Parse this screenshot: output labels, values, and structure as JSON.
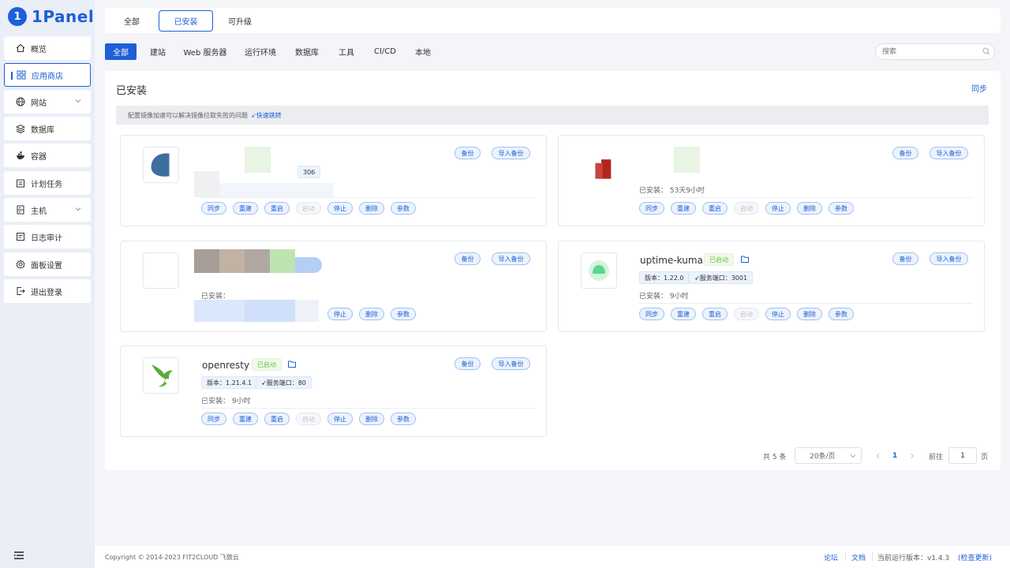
{
  "brand": {
    "name": "1Panel",
    "accent": "#1d5fd6"
  },
  "sidebar": {
    "items": [
      {
        "label": "概览",
        "icon": "home-icon"
      },
      {
        "label": "应用商店",
        "icon": "apps-grid-icon",
        "active": true
      },
      {
        "label": "网站",
        "icon": "globe-icon",
        "expandable": true
      },
      {
        "label": "数据库",
        "icon": "database-icon"
      },
      {
        "label": "容器",
        "icon": "docker-icon"
      },
      {
        "label": "计划任务",
        "icon": "calendar-icon"
      },
      {
        "label": "主机",
        "icon": "server-icon",
        "expandable": true
      },
      {
        "label": "日志审计",
        "icon": "log-icon"
      },
      {
        "label": "面板设置",
        "icon": "gear-icon"
      },
      {
        "label": "退出登录",
        "icon": "logout-icon"
      }
    ]
  },
  "top_tabs": [
    {
      "label": "全部"
    },
    {
      "label": "已安装",
      "active": true
    },
    {
      "label": "可升级"
    }
  ],
  "filters": [
    {
      "label": "全部",
      "active": true
    },
    {
      "label": "建站"
    },
    {
      "label": "Web 服务器"
    },
    {
      "label": "运行环境"
    },
    {
      "label": "数据库"
    },
    {
      "label": "工具"
    },
    {
      "label": "CI/CD"
    },
    {
      "label": "本地"
    }
  ],
  "search": {
    "placeholder": "搜索"
  },
  "panel": {
    "title": "已安装",
    "sync_label": "同步",
    "notice": "配置镜像加速可以解决镜像拉取失败的问题",
    "notice_link": "快速跳转"
  },
  "card_actions": [
    "同步",
    "重建",
    "重启",
    "启动",
    "停止",
    "删除",
    "参数"
  ],
  "card_top_actions": [
    "备份",
    "导入备份"
  ],
  "cards": [
    {
      "name": "",
      "status": "",
      "version": "",
      "port": "306",
      "installed": "",
      "obscured": true
    },
    {
      "name": "",
      "status": "",
      "version": "",
      "port": "",
      "installed": "已安装： 53天9小时",
      "obscured": true
    },
    {
      "name": "",
      "status": "",
      "version": "",
      "port": "",
      "installed": "已安装： ",
      "obscured": true
    },
    {
      "name": "uptime-kuma",
      "status": "已启动",
      "version": "版本：1.22.0",
      "port": "服务端口：3001",
      "installed": "已安装： 9小时"
    },
    {
      "name": "openresty",
      "status": "已启动",
      "version": "版本：1.21.4.1",
      "port": "服务端口：80",
      "installed": "已安装： 9小时"
    }
  ],
  "pagination": {
    "total": "共 5 条",
    "page_size": "20条/页",
    "current_page": "1",
    "goto_label": "前往",
    "goto_value": "1",
    "page_unit": "页"
  },
  "footer": {
    "copyright": "Copyright © 2014-2023 FIT2CLOUD 飞致云",
    "forum": "论坛",
    "docs": "文档",
    "version": "当前运行版本：v1.4.3",
    "check_update": "(检查更新)"
  }
}
